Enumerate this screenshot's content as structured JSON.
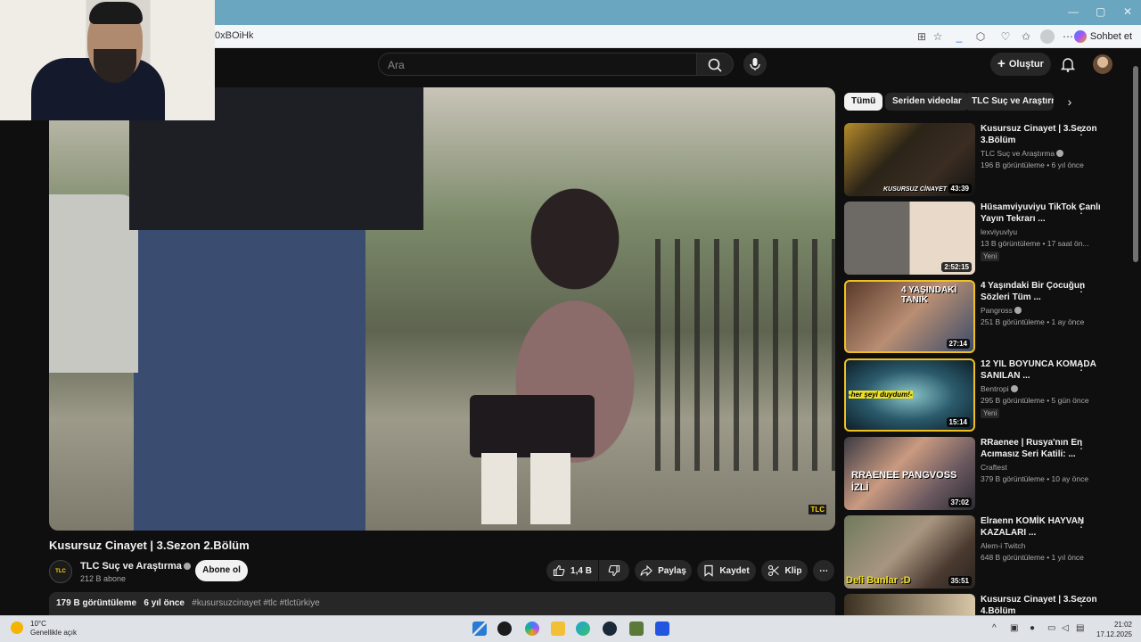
{
  "browser": {
    "url_fragment": "0xBOiHk",
    "chat_label": "Sohbet et"
  },
  "header": {
    "search_placeholder": "Ara",
    "create_label": "Oluştur"
  },
  "video": {
    "watermark": "TLC",
    "title": "Kusursuz Cinayet | 3.Sezon 2.Bölüm",
    "channel_badge": "TLC",
    "channel_name": "TLC Suç ve Araştırma",
    "subscribers": "212 B abone",
    "subscribe_label": "Abone ol",
    "likes": "1,4 B",
    "share_label": "Paylaş",
    "save_label": "Kaydet",
    "clip_label": "Klip",
    "views": "179 B görüntüleme",
    "age": "6 yıl önce",
    "tags": "#kusursuzcinayet #tlc #tlctürkiye"
  },
  "chips": [
    {
      "label": "Tümü"
    },
    {
      "label": "Seriden videolar"
    },
    {
      "label": "TLC Suç ve Araştırma"
    }
  ],
  "recommendations": [
    {
      "title": "Kusursuz Cinayet | 3.Sezon 3.Bölüm",
      "channel": "TLC Suç ve Araştırma",
      "meta": "196 B görüntüleme • 6 yıl önce",
      "duration": "43:39",
      "thumb_text": "KUSURSUZ CİNAYET"
    },
    {
      "title": "Hüsamviyuviyu TikTok Canlı Yayın Tekrarı ...",
      "channel": "lexviyuvlyu",
      "meta": "13 B görüntüleme • 17 saat ön...",
      "duration": "2:52:15",
      "badge": "Yeni"
    },
    {
      "title": "4 Yaşındaki Bir Çocuğun Sözleri Tüm ...",
      "channel": "Pangross",
      "meta": "251 B görüntüleme • 1 ay önce",
      "duration": "27:14",
      "thumb_text": "4 YAŞINDAKİ TANIK"
    },
    {
      "title": "12 YIL BOYUNCA KOMADA SANILAN ...",
      "channel": "Bentropi",
      "meta": "295 B görüntüleme • 5 gün önce",
      "duration": "15:14",
      "badge": "Yeni",
      "thumb_text": "-her şeyi duydum!-"
    },
    {
      "title": "RRaenee | Rusya'nın En Acımasız Seri Katili: ...",
      "channel": "Craftest",
      "meta": "379 B görüntüleme • 10 ay önce",
      "duration": "37:02",
      "thumb_text": "RRAENEE PANGVOSS İZLİ"
    },
    {
      "title": "Elraenn KOMİK HAYVAN KAZALARI ...",
      "channel": "Alem-i Twitch",
      "meta": "648 B görüntüleme • 1 yıl önce",
      "duration": "35:51",
      "thumb_text": "Deli Bunlar :D"
    },
    {
      "title": "Kusursuz Cinayet | 3.Sezon 4.Bölüm",
      "channel": "",
      "meta": "",
      "duration": ""
    }
  ],
  "taskbar": {
    "temperature": "10°C",
    "weather": "Genellikle açık",
    "time": "21:02",
    "date": "17.12.2025"
  }
}
